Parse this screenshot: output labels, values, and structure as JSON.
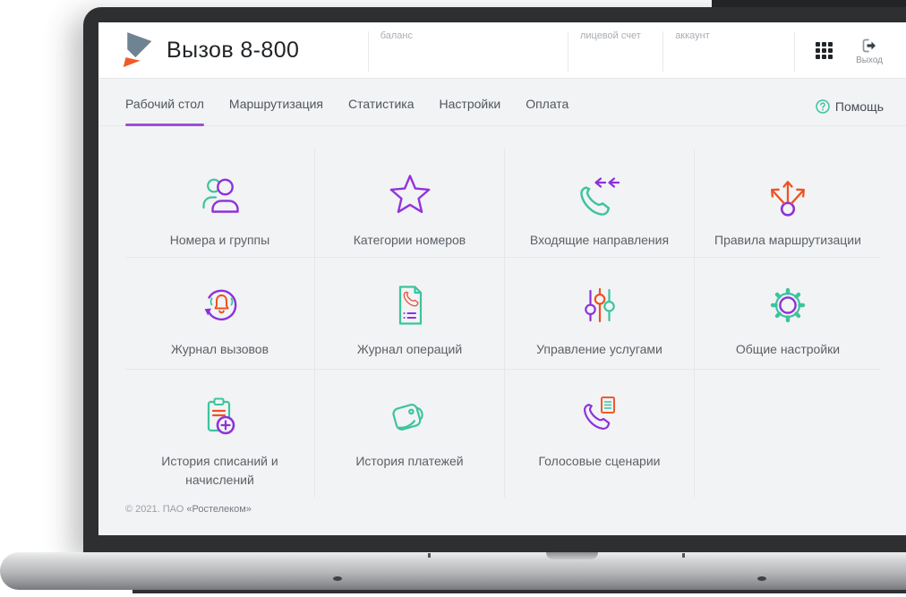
{
  "header": {
    "title": "Вызов 8-800",
    "info_fields": [
      {
        "label": "баланс"
      },
      {
        "label": "лицевой счет"
      },
      {
        "label": "аккаунт"
      }
    ],
    "logout_label": "Выход"
  },
  "nav": {
    "tabs": [
      {
        "label": "Рабочий стол",
        "active": true
      },
      {
        "label": "Маршрутизация",
        "active": false
      },
      {
        "label": "Статистика",
        "active": false
      },
      {
        "label": "Настройки",
        "active": false
      },
      {
        "label": "Оплата",
        "active": false
      }
    ],
    "help_label": "Помощь"
  },
  "tiles": [
    {
      "label": "Номера и группы",
      "icon": "users-icon"
    },
    {
      "label": "Категории номеров",
      "icon": "star-icon"
    },
    {
      "label": "Входящие направления",
      "icon": "incoming-call-icon"
    },
    {
      "label": "Правила маршрутизации",
      "icon": "routing-icon"
    },
    {
      "label": "Журнал вызовов",
      "icon": "call-log-icon"
    },
    {
      "label": "Журнал операций",
      "icon": "operations-log-icon"
    },
    {
      "label": "Управление услугами",
      "icon": "sliders-icon"
    },
    {
      "label": "Общие настройки",
      "icon": "gear-icon"
    },
    {
      "label": "История списаний и начислений",
      "icon": "clipboard-plus-icon"
    },
    {
      "label": "История платежей",
      "icon": "wallet-icon"
    },
    {
      "label": "Голосовые сценарии",
      "icon": "voice-scenario-icon"
    }
  ],
  "footer": {
    "copyright_prefix": "© 2021. ПАО ",
    "company": "«Ростелеком»"
  },
  "colors": {
    "teal": "#3cc49d",
    "purple": "#8d32da",
    "orange": "#ed5322",
    "active_tab_underline": "#9b4fd4",
    "screen_background": "#f2f3f5"
  }
}
